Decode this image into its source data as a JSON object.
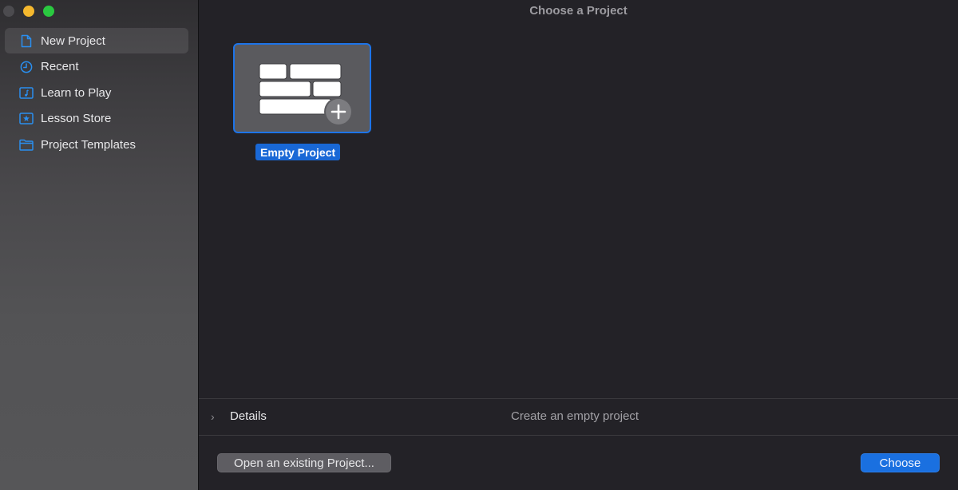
{
  "window": {
    "title": "Choose a Project",
    "traffic_lights": [
      "close",
      "minimize",
      "maximize"
    ]
  },
  "sidebar": {
    "items": [
      {
        "label": "New Project",
        "icon": "document-icon",
        "active": true
      },
      {
        "label": "Recent",
        "icon": "clock-icon",
        "active": false
      },
      {
        "label": "Learn to Play",
        "icon": "music-note-icon",
        "active": false
      },
      {
        "label": "Lesson Store",
        "icon": "star-icon",
        "active": false
      },
      {
        "label": "Project Templates",
        "icon": "folder-icon",
        "active": false
      }
    ]
  },
  "main": {
    "projects": [
      {
        "label": "Empty Project",
        "icon": "empty-project-add-icon",
        "selected": true
      }
    ]
  },
  "details": {
    "label": "Details",
    "description": "Create an empty project"
  },
  "footer": {
    "open_label": "Open an existing Project...",
    "choose_label": "Choose"
  },
  "colors": {
    "accent": "#1a70e0",
    "icon_blue": "#2a8ff0"
  }
}
